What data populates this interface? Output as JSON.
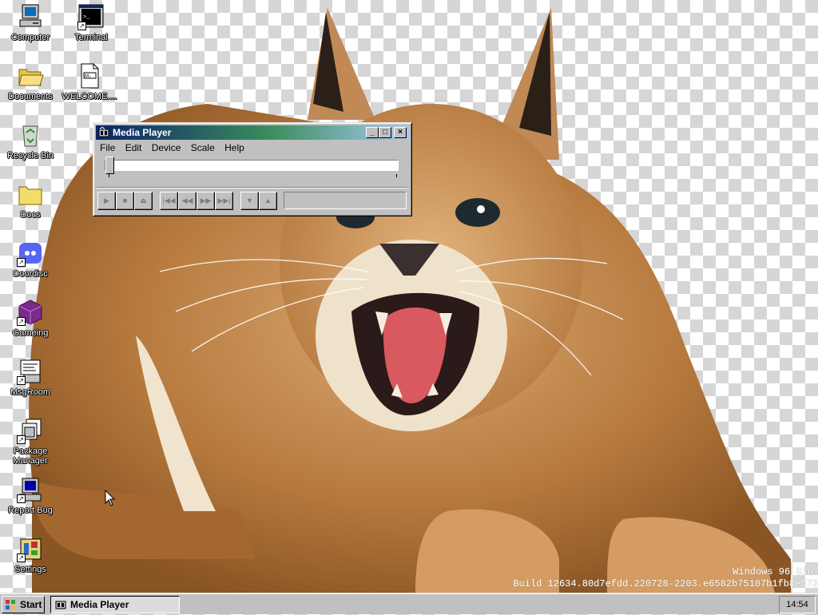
{
  "desktop": {
    "icons": [
      {
        "label": "Computer",
        "icon": "computer-icon"
      },
      {
        "label": "Terminal",
        "icon": "terminal-icon"
      },
      {
        "label": "Documents",
        "icon": "folder-open-icon"
      },
      {
        "label": "WELCOME....",
        "icon": "markdown-file-icon"
      },
      {
        "label": "Recycle Bin",
        "icon": "recycle-bin-icon"
      },
      {
        "label": "Docs",
        "icon": "folder-icon"
      },
      {
        "label": "Doordisc",
        "icon": "doordisc-icon"
      },
      {
        "label": "Gameing",
        "icon": "game-cube-icon"
      },
      {
        "label": "MsgRoom",
        "icon": "msgroom-icon"
      },
      {
        "label": "Package Manager",
        "icon": "package-icon"
      },
      {
        "label": "Report Bug",
        "icon": "report-bug-icon"
      },
      {
        "label": "Settings",
        "icon": "settings-icon"
      }
    ],
    "watermark": {
      "line1": "Windows 96 Gin",
      "line2": "Build 12634.80d7efdd.220728-2203.e6582b75107b1fb8e572"
    }
  },
  "media_player": {
    "title": "Media Player",
    "menu": [
      "File",
      "Edit",
      "Device",
      "Scale",
      "Help"
    ],
    "controls": [
      "play",
      "stop",
      "eject",
      "previous-mark",
      "rewind",
      "fast-forward",
      "next-mark",
      "start-selection",
      "end-selection"
    ],
    "position": 0
  },
  "taskbar": {
    "start_label": "Start",
    "task_label": "Media Player",
    "clock": "14:54"
  },
  "colors": {
    "desktop_checker": "#d6d6d6",
    "window_face": "#c0c0c0",
    "title_gradient_start": "#0a246a",
    "title_gradient_end": "#a6caf0"
  }
}
